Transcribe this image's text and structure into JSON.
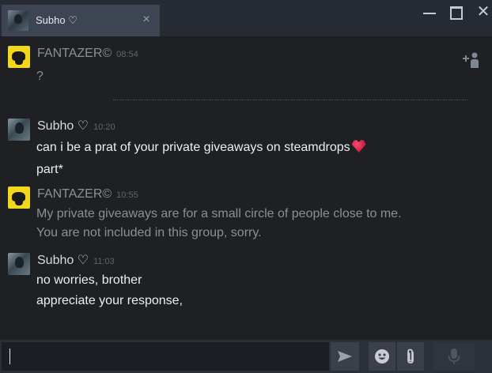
{
  "tab": {
    "contact_name": "Subho ♡",
    "close_glyph": "×"
  },
  "window_controls": {
    "close_glyph": "✕"
  },
  "messages": [
    {
      "sender": "FANTAZER©",
      "time": "08:54",
      "lines": [
        "?"
      ]
    },
    {
      "sender": "Subho ♡",
      "time": "10:20",
      "lines": [
        "can i be a prat of your private giveaways on steamdrops",
        "part*"
      ]
    },
    {
      "sender": "FANTAZER©",
      "time": "10:55",
      "lines": [
        "My private giveaways are for a small circle of people close to me.",
        "You are not included in this group, sorry."
      ]
    },
    {
      "sender": "Subho ♡",
      "time": "11:03",
      "lines": [
        "no worries, brother",
        "appreciate your response,"
      ]
    }
  ],
  "input": {
    "value": ""
  },
  "colors": {
    "background": "#1e2024",
    "titlebar": "#262a33",
    "active_tab": "#3e4552",
    "other_user_text": "#8b9096",
    "self_text": "#eceef0",
    "timestamp": "#5d6670",
    "footer": "#2b2f38"
  },
  "icons": {
    "add_friend": "add-user-icon",
    "send": "send-arrow-icon",
    "emoticon": "smiley-icon",
    "attach": "paperclip-icon",
    "voice": "microphone-icon",
    "message_emoji": "heart-emoji"
  }
}
